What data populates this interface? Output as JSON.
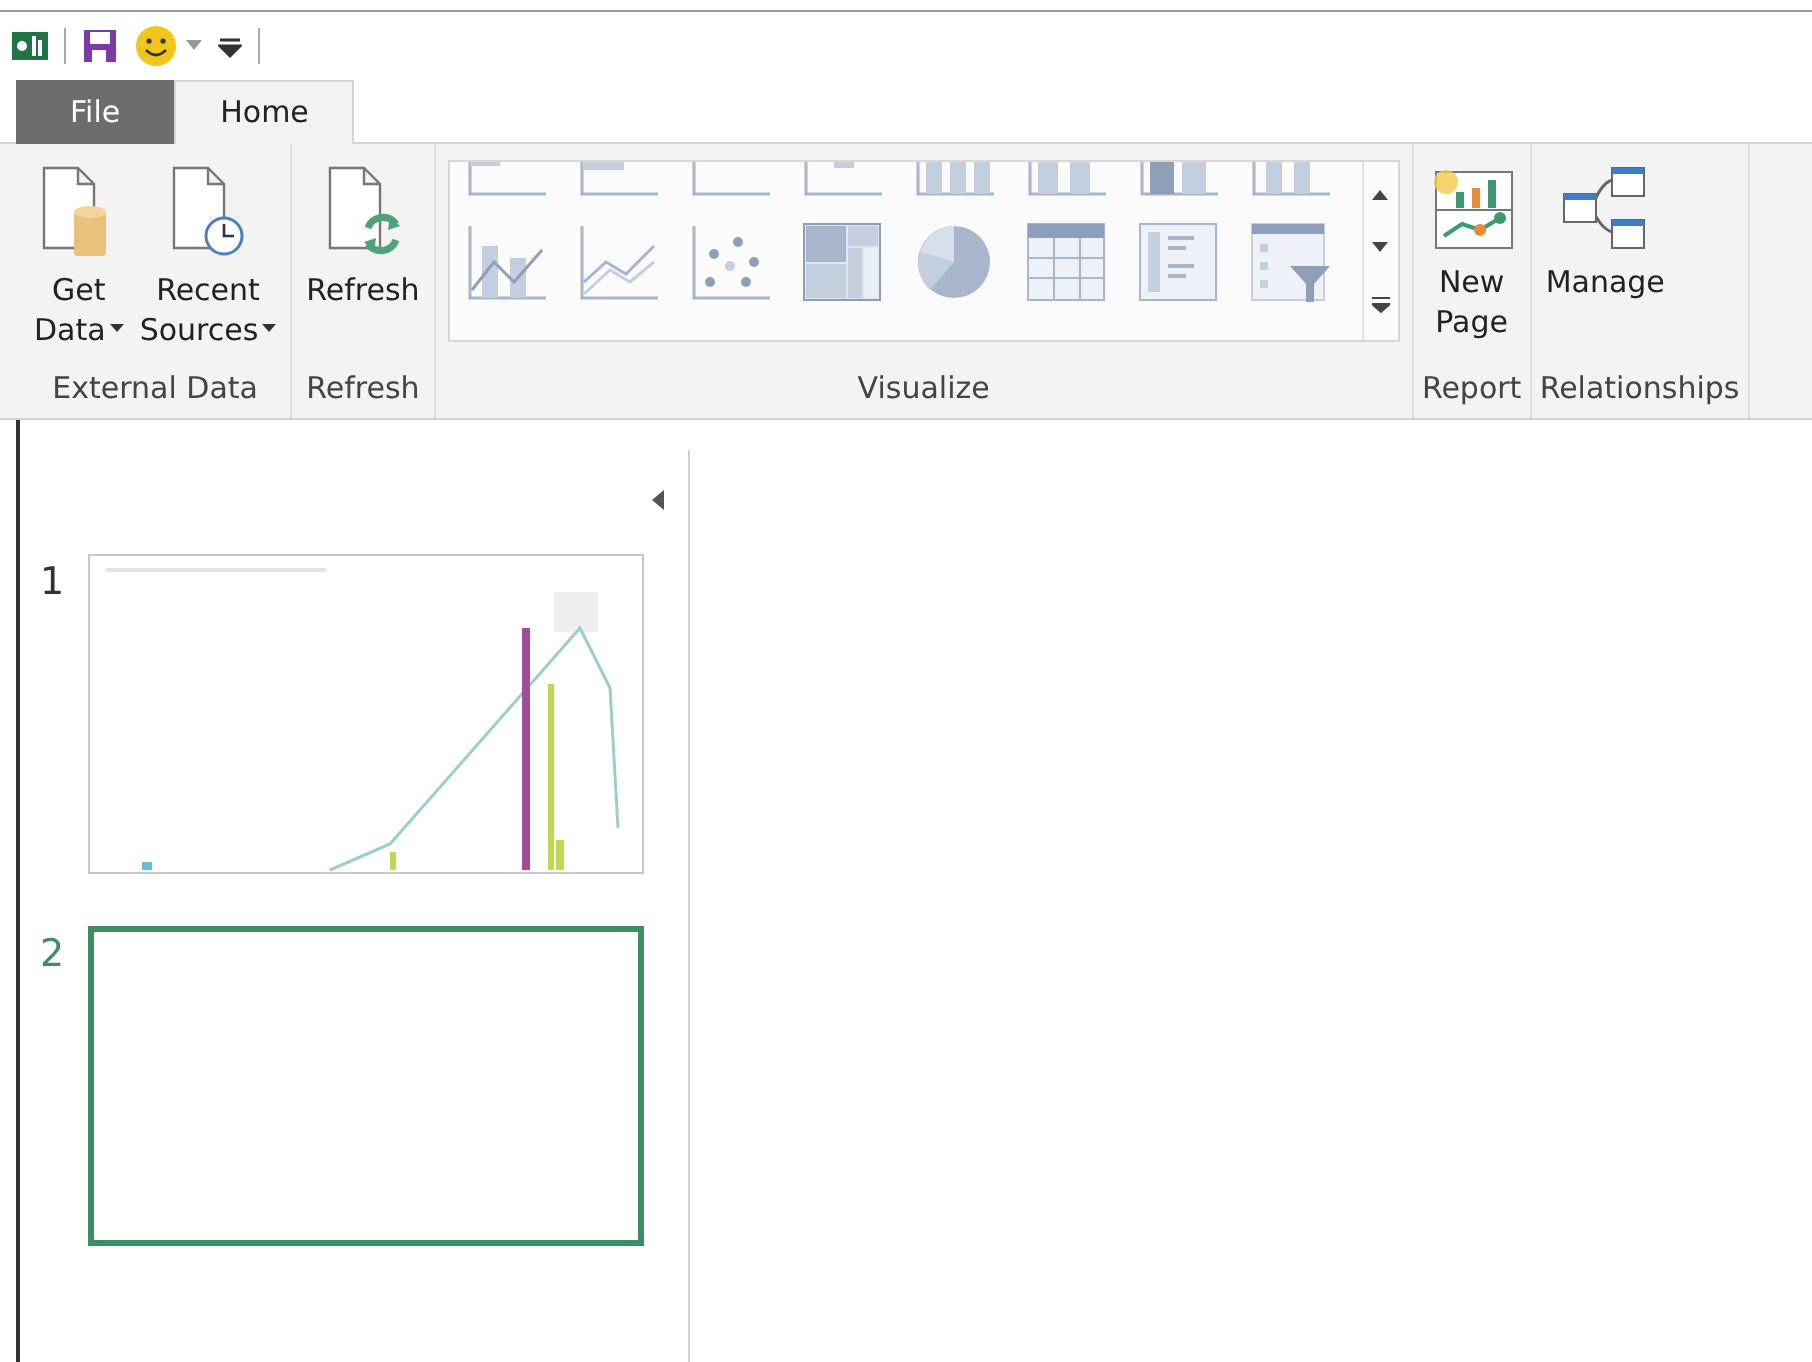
{
  "tabs": [
    {
      "label": "File",
      "kind": "file",
      "selected": false
    },
    {
      "label": "Home",
      "kind": "tab",
      "selected": true
    }
  ],
  "ribbon_groups": [
    {
      "label": "External Data",
      "kind": "buttons",
      "buttons": [
        {
          "lines": [
            "Get",
            "Data"
          ],
          "kind": "get-data",
          "dropdown": true
        },
        {
          "lines": [
            "Recent",
            "Sources"
          ],
          "kind": "recent",
          "dropdown": true
        }
      ]
    },
    {
      "label": "Refresh",
      "kind": "buttons",
      "buttons": [
        {
          "lines": [
            "Refresh"
          ],
          "kind": "refresh",
          "dropdown": false
        }
      ]
    },
    {
      "label": "Visualize",
      "kind": "gallery",
      "rows": [
        [
          {
            "kind": "stacked-bar"
          },
          {
            "kind": "clustered-bar"
          },
          {
            "kind": "full-bar"
          },
          {
            "kind": "funnel"
          },
          {
            "kind": "stacked-column"
          },
          {
            "kind": "clustered-column"
          },
          {
            "kind": "full-column"
          },
          {
            "kind": "line-column-top"
          }
        ],
        [
          {
            "kind": "line-column"
          },
          {
            "kind": "line"
          },
          {
            "kind": "scatter"
          },
          {
            "kind": "treemap"
          },
          {
            "kind": "pie"
          },
          {
            "kind": "table"
          },
          {
            "kind": "matrix"
          },
          {
            "kind": "slicer"
          }
        ]
      ]
    },
    {
      "label": "Report",
      "kind": "buttons",
      "buttons": [
        {
          "lines": [
            "New",
            "Page"
          ],
          "kind": "new-page",
          "dropdown": false
        }
      ]
    },
    {
      "label": "Relationships",
      "kind": "buttons",
      "buttons": [
        {
          "lines": [
            "Manage"
          ],
          "kind": "manage",
          "dropdown": false
        }
      ]
    }
  ],
  "pages": [
    {
      "number": "1",
      "selected": false,
      "kind": "chart"
    },
    {
      "number": "2",
      "selected": true,
      "kind": "blank"
    }
  ]
}
